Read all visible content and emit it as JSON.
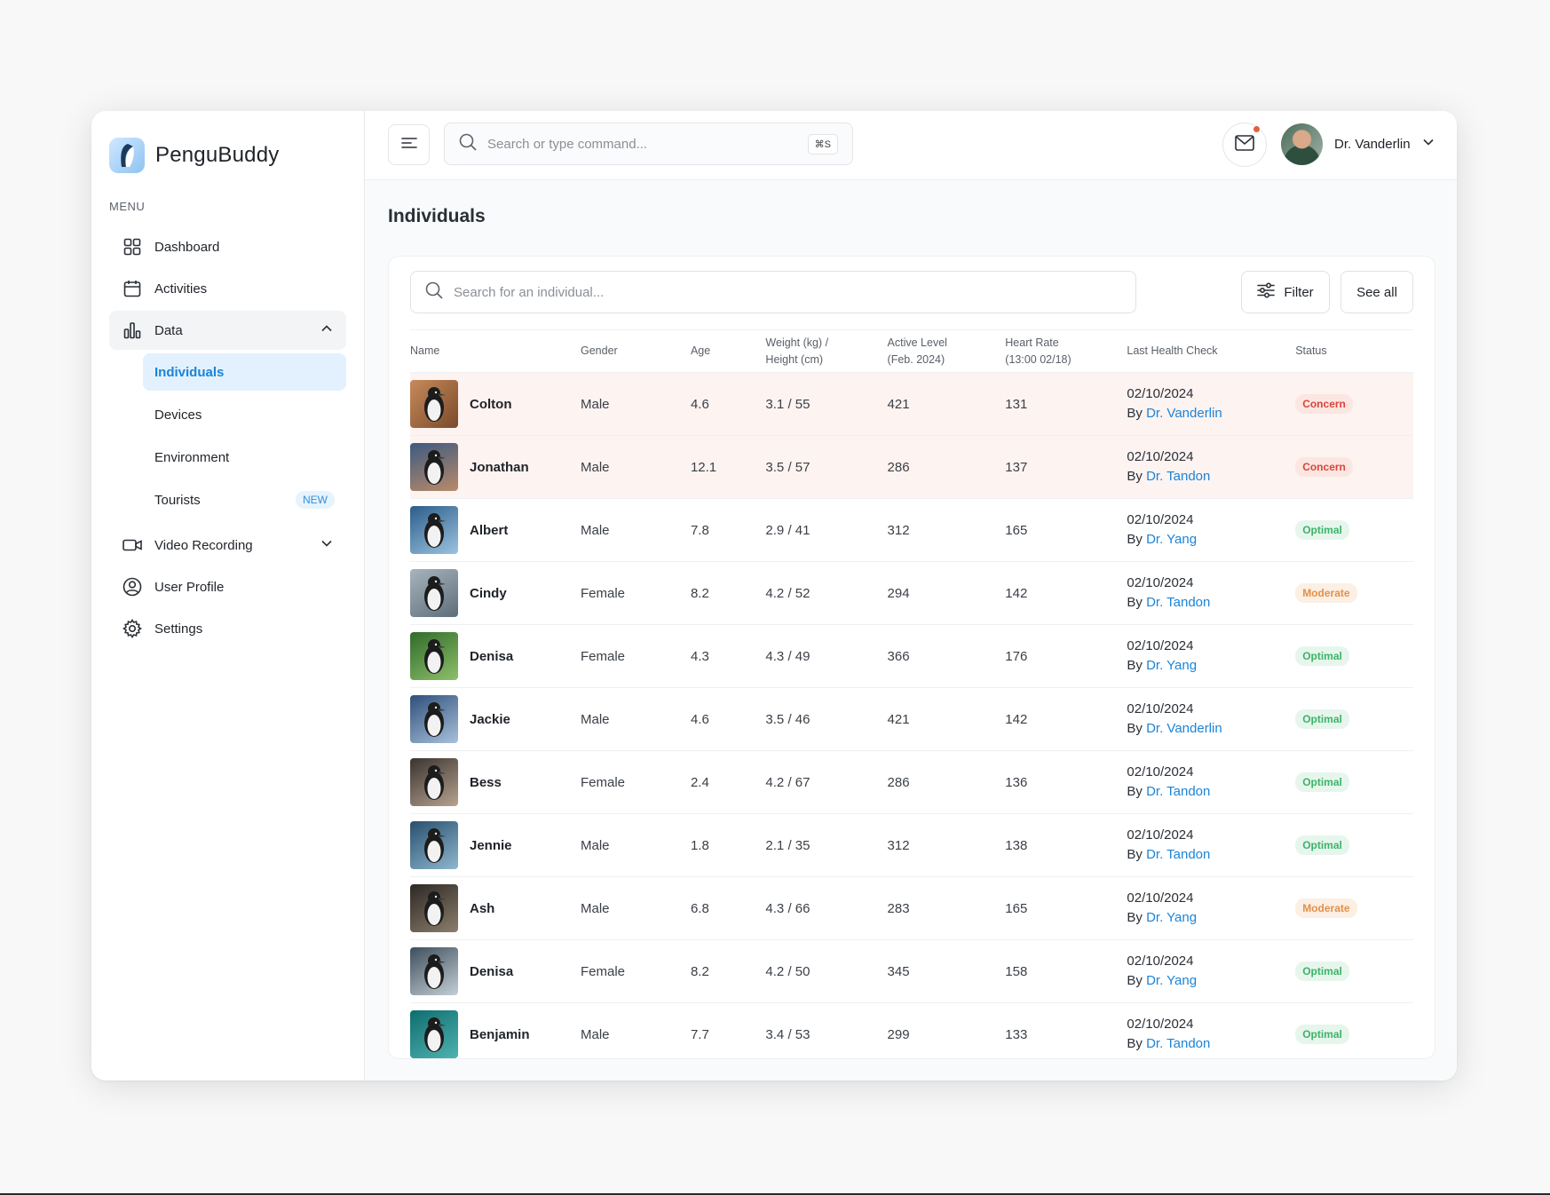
{
  "app": {
    "name": "PenguBuddy"
  },
  "sidebar": {
    "menu_label": "MENU",
    "items": [
      {
        "label": "Dashboard",
        "icon": "grid-icon"
      },
      {
        "label": "Activities",
        "icon": "calendar-icon"
      },
      {
        "label": "Data",
        "icon": "bar-chart-icon",
        "expanded": true,
        "children": [
          {
            "label": "Individuals",
            "active": true
          },
          {
            "label": "Devices"
          },
          {
            "label": "Environment"
          },
          {
            "label": "Tourists",
            "badge": "NEW"
          }
        ]
      },
      {
        "label": "Video Recording",
        "icon": "video-icon"
      },
      {
        "label": "User Profile",
        "icon": "user-circle-icon"
      },
      {
        "label": "Settings",
        "icon": "gear-icon"
      }
    ]
  },
  "topbar": {
    "search_placeholder": "Search or type command...",
    "shortcut": "⌘S",
    "user_name": "Dr. Vanderlin",
    "has_unread_mail": true
  },
  "page": {
    "title": "Individuals",
    "search_placeholder": "Search for an individual...",
    "filter_label": "Filter",
    "see_all_label": "See all"
  },
  "table": {
    "headers": {
      "name": "Name",
      "gender": "Gender",
      "age": "Age",
      "weight_l1": "Weight (kg) /",
      "weight_l2": "Height (cm)",
      "active_l1": "Active Level",
      "active_l2": "(Feb. 2024)",
      "heart_l1": "Heart Rate",
      "heart_l2": "(13:00 02/18)",
      "check": "Last Health Check",
      "status": "Status"
    },
    "rows": [
      {
        "name": "Colton",
        "gender": "Male",
        "age": "4.6",
        "wh": "3.1 / 55",
        "active": "421",
        "heart": "131",
        "date": "02/10/2024",
        "by": "By",
        "doctor": "Dr. Vanderlin",
        "status": "Concern"
      },
      {
        "name": "Jonathan",
        "gender": "Male",
        "age": "12.1",
        "wh": "3.5 / 57",
        "active": "286",
        "heart": "137",
        "date": "02/10/2024",
        "by": "By",
        "doctor": "Dr. Tandon",
        "status": "Concern"
      },
      {
        "name": "Albert",
        "gender": "Male",
        "age": "7.8",
        "wh": "2.9 / 41",
        "active": "312",
        "heart": "165",
        "date": "02/10/2024",
        "by": "By",
        "doctor": "Dr. Yang",
        "status": "Optimal"
      },
      {
        "name": "Cindy",
        "gender": "Female",
        "age": "8.2",
        "wh": "4.2 / 52",
        "active": "294",
        "heart": "142",
        "date": "02/10/2024",
        "by": "By",
        "doctor": "Dr. Tandon",
        "status": "Moderate"
      },
      {
        "name": "Denisa",
        "gender": "Female",
        "age": "4.3",
        "wh": "4.3 / 49",
        "active": "366",
        "heart": "176",
        "date": "02/10/2024",
        "by": "By",
        "doctor": "Dr. Yang",
        "status": "Optimal"
      },
      {
        "name": "Jackie",
        "gender": "Male",
        "age": "4.6",
        "wh": "3.5 / 46",
        "active": "421",
        "heart": "142",
        "date": "02/10/2024",
        "by": "By",
        "doctor": "Dr. Vanderlin",
        "status": "Optimal"
      },
      {
        "name": "Bess",
        "gender": "Female",
        "age": "2.4",
        "wh": "4.2 / 67",
        "active": "286",
        "heart": "136",
        "date": "02/10/2024",
        "by": "By",
        "doctor": "Dr. Tandon",
        "status": "Optimal"
      },
      {
        "name": "Jennie",
        "gender": "Male",
        "age": "1.8",
        "wh": "2.1 / 35",
        "active": "312",
        "heart": "138",
        "date": "02/10/2024",
        "by": "By",
        "doctor": "Dr. Tandon",
        "status": "Optimal"
      },
      {
        "name": "Ash",
        "gender": "Male",
        "age": "6.8",
        "wh": "4.3 / 66",
        "active": "283",
        "heart": "165",
        "date": "02/10/2024",
        "by": "By",
        "doctor": "Dr. Yang",
        "status": "Moderate"
      },
      {
        "name": "Denisa",
        "gender": "Female",
        "age": "8.2",
        "wh": "4.2 / 50",
        "active": "345",
        "heart": "158",
        "date": "02/10/2024",
        "by": "By",
        "doctor": "Dr. Yang",
        "status": "Optimal"
      },
      {
        "name": "Benjamin",
        "gender": "Male",
        "age": "7.7",
        "wh": "3.4 / 53",
        "active": "299",
        "heart": "133",
        "date": "02/10/2024",
        "by": "By",
        "doctor": "Dr. Tandon",
        "status": "Optimal"
      }
    ]
  },
  "colors": {
    "accent": "#1b84d8",
    "concern": "#d9453a",
    "optimal": "#3cb36a",
    "moderate": "#e3914b",
    "concern_row_bg": "#fdf3f1"
  }
}
